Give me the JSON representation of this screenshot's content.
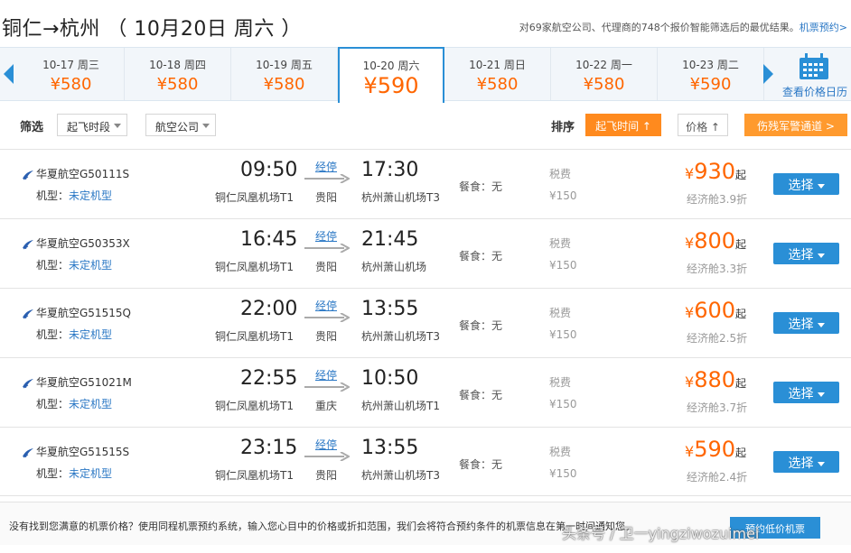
{
  "header": {
    "title": "铜仁→杭州 （ 10月20日 周六 ）",
    "info": "对69家航空公司、代理商的748个报价智能筛选后的最优结果。",
    "booking_link": "机票预约>"
  },
  "dates": [
    {
      "date": "10-17 周三",
      "price": "¥580"
    },
    {
      "date": "10-18 周四",
      "price": "¥580"
    },
    {
      "date": "10-19 周五",
      "price": "¥580"
    },
    {
      "date": "10-20 周六",
      "price": "¥590"
    },
    {
      "date": "10-21 周日",
      "price": "¥580"
    },
    {
      "date": "10-22 周一",
      "price": "¥580"
    },
    {
      "date": "10-23 周二",
      "price": "¥590"
    }
  ],
  "active_date_index": 3,
  "calendar_label": "查看价格日历",
  "filter": {
    "label": "筛选",
    "time_dropdown": "起飞时段",
    "airline_dropdown": "航空公司",
    "sort_label": "排序",
    "sort_time": "起飞时间 ↑",
    "sort_price": "价格 ↑",
    "military": "伤残军警通道 >"
  },
  "flights": [
    {
      "airline": "华夏航空G50111S",
      "plane_label": "机型：",
      "plane": "未定机型",
      "dep_time": "09:50",
      "dep_airport": "铜仁凤凰机场T1",
      "stop_label": "经停",
      "stop_city": "贵阳",
      "arr_time": "17:30",
      "arr_airport": "杭州萧山机场T3",
      "meal": "餐食：无",
      "tax_label": "税费",
      "tax": "¥150",
      "price_currency": "¥",
      "price": "930",
      "price_suffix": "起",
      "cabin": "经济舱3.9折",
      "btn": "选择"
    },
    {
      "airline": "华夏航空G50353X",
      "plane_label": "机型：",
      "plane": "未定机型",
      "dep_time": "16:45",
      "dep_airport": "铜仁凤凰机场T1",
      "stop_label": "经停",
      "stop_city": "贵阳",
      "arr_time": "21:45",
      "arr_airport": "杭州萧山机场",
      "meal": "餐食：无",
      "tax_label": "税费",
      "tax": "¥150",
      "price_currency": "¥",
      "price": "800",
      "price_suffix": "起",
      "cabin": "经济舱3.3折",
      "btn": "选择"
    },
    {
      "airline": "华夏航空G51515Q",
      "plane_label": "机型：",
      "plane": "未定机型",
      "dep_time": "22:00",
      "dep_airport": "铜仁凤凰机场T1",
      "stop_label": "经停",
      "stop_city": "贵阳",
      "arr_time": "13:55",
      "arr_airport": "杭州萧山机场T3",
      "meal": "餐食：无",
      "tax_label": "税费",
      "tax": "¥150",
      "price_currency": "¥",
      "price": "600",
      "price_suffix": "起",
      "cabin": "经济舱2.5折",
      "btn": "选择"
    },
    {
      "airline": "华夏航空G51021M",
      "plane_label": "机型：",
      "plane": "未定机型",
      "dep_time": "22:55",
      "dep_airport": "铜仁凤凰机场T1",
      "stop_label": "经停",
      "stop_city": "重庆",
      "arr_time": "10:50",
      "arr_airport": "杭州萧山机场T1",
      "meal": "餐食：无",
      "tax_label": "税费",
      "tax": "¥150",
      "price_currency": "¥",
      "price": "880",
      "price_suffix": "起",
      "cabin": "经济舱3.7折",
      "btn": "选择"
    },
    {
      "airline": "华夏航空G51515S",
      "plane_label": "机型：",
      "plane": "未定机型",
      "dep_time": "23:15",
      "dep_airport": "铜仁凤凰机场T1",
      "stop_label": "经停",
      "stop_city": "贵阳",
      "arr_time": "13:55",
      "arr_airport": "杭州萧山机场T3",
      "meal": "餐食：无",
      "tax_label": "税费",
      "tax": "¥150",
      "price_currency": "¥",
      "price": "590",
      "price_suffix": "起",
      "cabin": "经济舱2.4折",
      "btn": "选择"
    }
  ],
  "notice": {
    "text": "没有找到您满意的机票价格？使用同程机票预约系统，输入您心目中的价格或折扣范围，我们会将符合预约条件的机票信息在第一时间通知您。",
    "button": "预约低价机票"
  },
  "watermark": "头条号 / 卫一yingziwozuimei",
  "colors": {
    "accent_blue": "#2a8fd6",
    "price_orange": "#ff6600",
    "sort_orange": "#ff8a1e"
  }
}
